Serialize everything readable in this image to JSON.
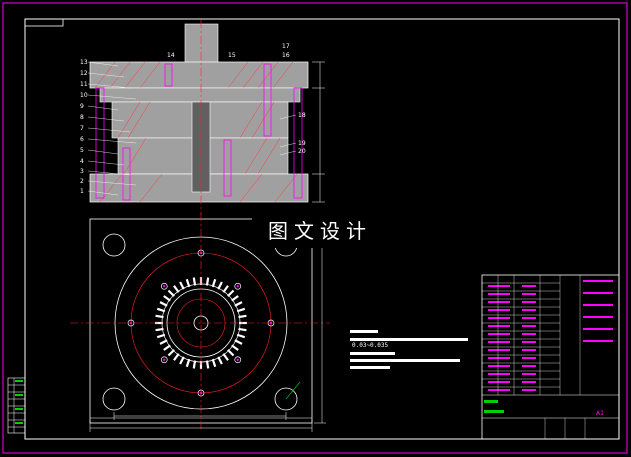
{
  "drawing": {
    "watermark": "图文设计",
    "colors": {
      "frame": "#ff00ff",
      "part_fill": "#a0a0a0",
      "hatch": "#ff3a3a",
      "center_line": "#ff2020",
      "outline": "#ffffff",
      "dimension": "#00d000",
      "highlight": "#ff00ff",
      "label": "#ffffff",
      "leader": "#ffff00"
    },
    "balloons_left": [
      "13",
      "12",
      "11",
      "10",
      "9",
      "8",
      "7",
      "6",
      "5",
      "4",
      "3",
      "2",
      "1"
    ],
    "balloons_top": [
      "14",
      "15",
      "17",
      "16"
    ],
    "balloons_right": [
      "18",
      "19",
      "20"
    ],
    "tech_notes": [
      "0.03~0.035"
    ],
    "title_block": {
      "sheet": "A1"
    }
  }
}
